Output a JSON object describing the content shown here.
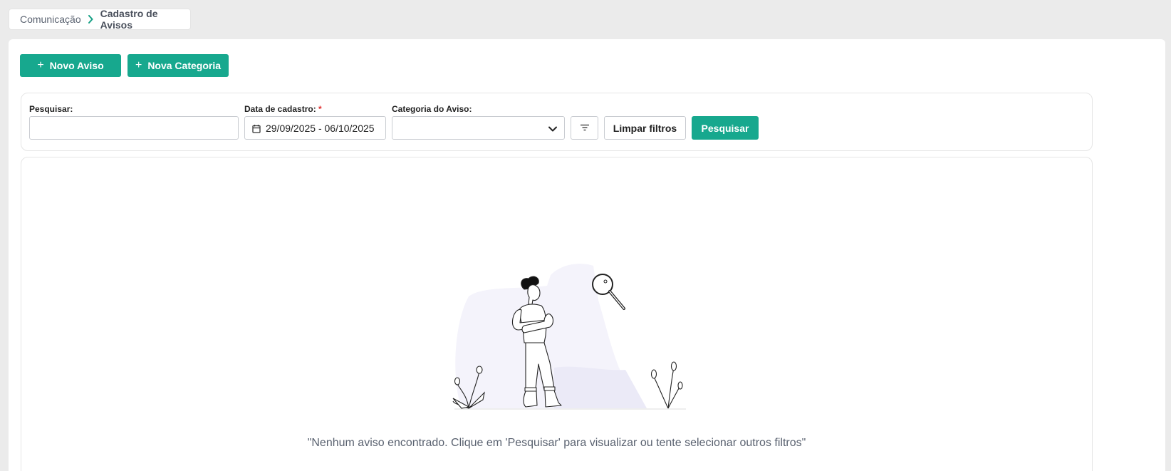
{
  "breadcrumb": {
    "parent": "Comunicação",
    "current": "Cadastro de Avisos"
  },
  "actions": {
    "new_notice": "Novo Aviso",
    "new_category": "Nova Categoria"
  },
  "filters": {
    "search_label": "Pesquisar:",
    "search_value": "",
    "date_label": "Data de cadastro:",
    "date_required_mark": "*",
    "date_value": "29/09/2025 - 06/10/2025",
    "category_label": "Categoria do Aviso:",
    "category_value": "",
    "clear_label": "Limpar filtros",
    "search_button": "Pesquisar"
  },
  "icons": {
    "breadcrumb_separator": "chevron-right-icon",
    "plus": "plus-icon",
    "calendar": "calendar-icon",
    "dropdown": "chevron-down-icon",
    "filter": "filter-icon"
  },
  "colors": {
    "accent": "#17a88e",
    "required": "#e03131",
    "background": "#ebebeb"
  },
  "empty_state": {
    "message": "\"Nenhum aviso encontrado. Clique em 'Pesquisar' para visualizar ou tente selecionar outros filtros\""
  }
}
